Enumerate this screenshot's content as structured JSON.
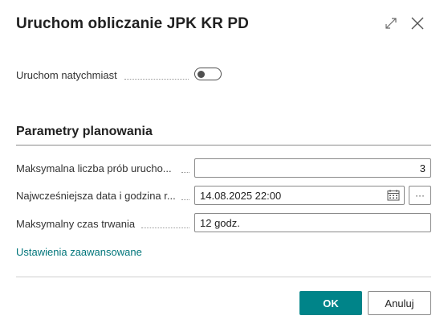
{
  "dialog": {
    "title": "Uruchom obliczanie JPK KR PD"
  },
  "run_now": {
    "label": "Uruchom natychmiast",
    "value": false
  },
  "planning": {
    "section_title": "Parametry planowania",
    "fields": [
      {
        "label": "Maksymalna liczba prób urucho...",
        "value": "3"
      },
      {
        "label": "Najwcześniejsza data i godzina r...",
        "value": "14.08.2025 22:00"
      },
      {
        "label": "Maksymalny czas trwania",
        "value": "12 godz."
      }
    ],
    "ellipsis_label": "···"
  },
  "advanced_link": "Ustawienia zaawansowane",
  "buttons": {
    "ok_label": "OK",
    "cancel_label": "Anuluj"
  },
  "colors": {
    "accent": "#008489",
    "link": "#00757a"
  },
  "icons": [
    "expand-icon",
    "close-icon",
    "calendar-icon"
  ]
}
